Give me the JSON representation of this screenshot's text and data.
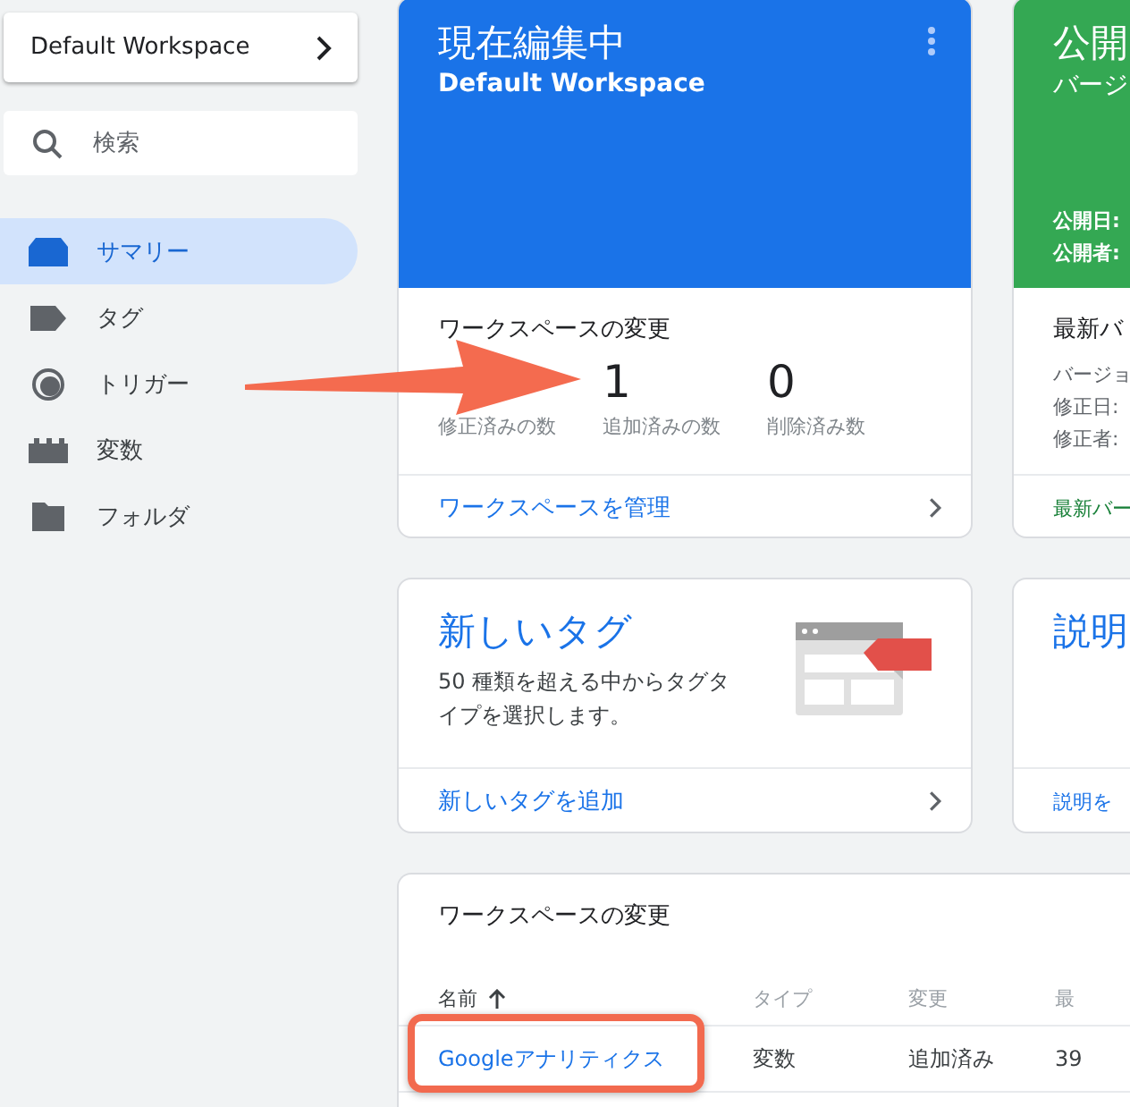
{
  "sidebar": {
    "workspace": "Default Workspace",
    "search": {
      "placeholder": "検索"
    },
    "items": [
      {
        "label": "サマリー",
        "selected": true
      },
      {
        "label": "タグ",
        "selected": false
      },
      {
        "label": "トリガー",
        "selected": false
      },
      {
        "label": "変数",
        "selected": false
      },
      {
        "label": "フォルダ",
        "selected": false
      }
    ]
  },
  "current_card": {
    "title": "現在編集中",
    "subtitle": "Default Workspace",
    "section": "ワークスペースの変更",
    "stats": [
      {
        "label": "修正済みの数"
      },
      {
        "value": "1",
        "label": "追加済みの数"
      },
      {
        "value": "0",
        "label": "削除済み数"
      }
    ],
    "link": "ワークスペースを管理"
  },
  "published_card": {
    "title": "公開",
    "subtitle": "バージ",
    "meta": [
      "公開日:",
      "公開者:"
    ],
    "section": "最新バ",
    "details": [
      "バージョ",
      "修正日:",
      "修正者:"
    ],
    "link": "最新バー"
  },
  "new_tag_card": {
    "title": "新しいタグ",
    "description": "50 種類を超える中からタグタイプを選択します。",
    "link": "新しいタグを追加"
  },
  "description_card": {
    "title": "説明",
    "link": "説明を"
  },
  "changes_table": {
    "title": "ワークスペースの変更",
    "columns": [
      {
        "label": "名前",
        "sorted": true
      },
      {
        "label": "タイプ",
        "sorted": false
      },
      {
        "label": "変更",
        "sorted": false
      },
      {
        "label": "最",
        "sorted": false
      }
    ],
    "rows": [
      {
        "cells": [
          "Googleアナリティクス",
          "変数",
          "追加済み",
          "39"
        ]
      }
    ]
  }
}
